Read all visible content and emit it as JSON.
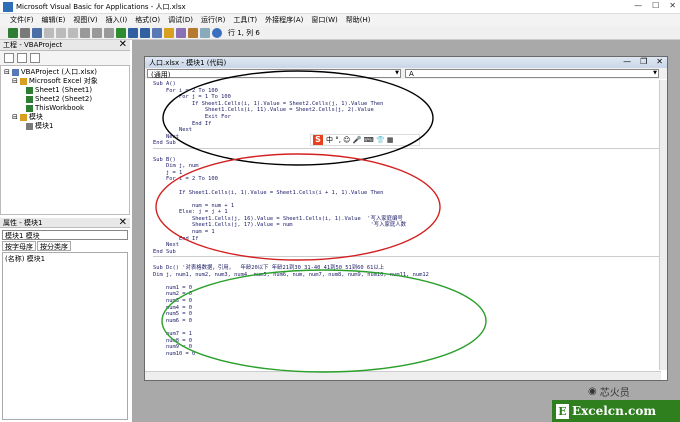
{
  "titlebar": {
    "title": "Microsoft Visual Basic for Applications - 人口.xlsx"
  },
  "menu": [
    "文件(F)",
    "编辑(E)",
    "视图(V)",
    "插入(I)",
    "格式(O)",
    "调试(D)",
    "运行(R)",
    "工具(T)",
    "外接程序(A)",
    "窗口(W)",
    "帮助(H)"
  ],
  "toolbar": {
    "position": "行 1, 列 6"
  },
  "project": {
    "header": "工程 - VBAProject",
    "tree": [
      "VBAProject (人口.xlsx)",
      "Microsoft Excel 对象",
      "Sheet1 (Sheet1)",
      "Sheet2 (Sheet2)",
      "ThisWorkbook",
      "模块",
      "模块1"
    ]
  },
  "properties": {
    "header": "属性 - 模块1",
    "select": "模块1 模块",
    "tabs": [
      "按字母序",
      "按分类序"
    ],
    "row": "(名称) 模块1"
  },
  "code_window": {
    "title": "人口.xlsx - 模块1 (代码)",
    "left_dropdown": "(通用)",
    "right_dropdown": "A",
    "lines": [
      "Sub A()",
      "    For i = 2 To 100",
      "        For j = 1 To 100",
      "            If Sheet1.Cells(i, 1).Value = Sheet2.Cells(j, 1).Value Then",
      "                Sheet1.Cells(i, 11).Value = Sheet2.Cells(j, 2).Value",
      "                Exit For",
      "            End If",
      "        Next",
      "    Next",
      "End Sub",
      "",
      "Sub B()",
      "    Dim j, num",
      "    j = 1",
      "    For i = 2 To 100",
      "",
      "        If Sheet1.Cells(i, 1).Value = Sheet1.Cells(i + 1, 1).Value Then",
      "",
      "            num = num + 1",
      "        Else: j = j + 1",
      "            Sheet1.Cells(j, 16).Value = Sheet1.Cells(i, 1).Value  '写入家庭编号",
      "            Sheet1.Cells(j, 17).Value = num                        '写入家庭人数",
      "            num = 1",
      "        End If",
      "    Next",
      "End Sub",
      "",
      "Sub Dc() '对表格数据，引用，  年龄20以下 年龄21到30 31-40 41到50 51到60 61以上",
      "Dim j, num1, num2, num3, num4, num5, num6, num, num7, num8, num9, num10, num11, num12",
      "",
      "    num1 = 0",
      "    num2 = 0",
      "    num3 = 0",
      "    num4 = 0",
      "    num5 = 0",
      "    num6 = 0",
      "",
      "    num7 = 1",
      "    num8 = 0",
      "    num9 = 0",
      "    num10 = 0"
    ]
  },
  "ime": {
    "logo": "S",
    "text": "中 °, ☺ 🎤 ⌨ 👕 ▦"
  },
  "watermark": {
    "wechat": "芯火员",
    "site": "Excelcn.com",
    "site_letter": "E"
  },
  "colors": {
    "ellipse_black": "#000000",
    "ellipse_red": "#d42020",
    "ellipse_green": "#2aa02a"
  }
}
